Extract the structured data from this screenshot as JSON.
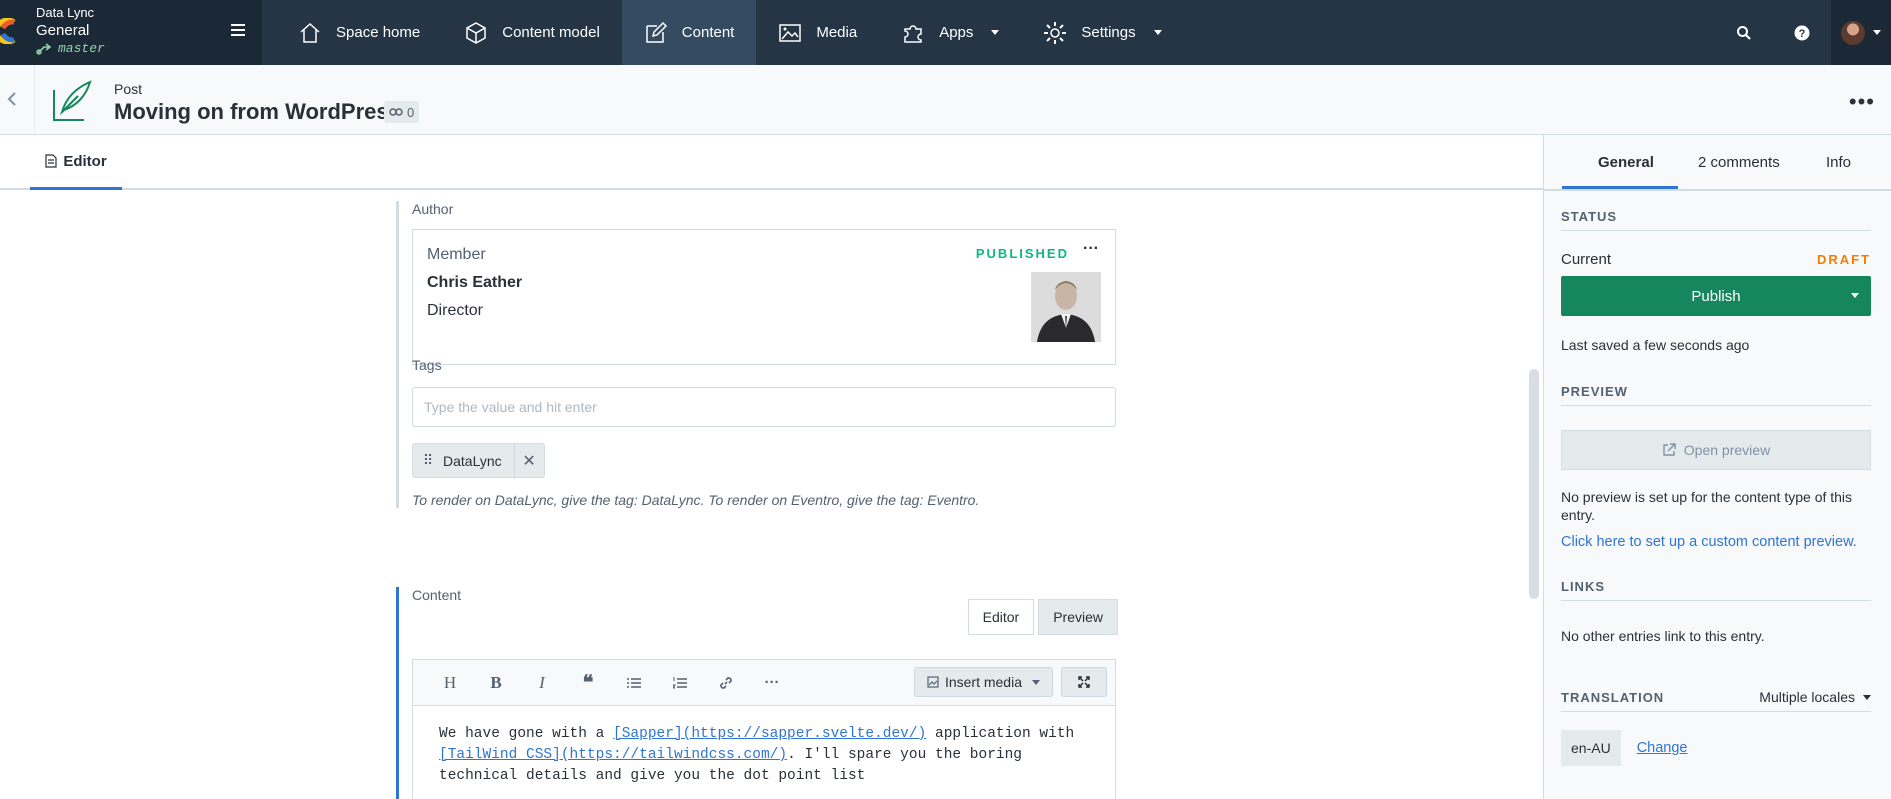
{
  "topnav": {
    "space_org": "Data Lync",
    "space_name": "General",
    "environment": "master",
    "items": [
      {
        "label": "Space home",
        "icon": "house-icon"
      },
      {
        "label": "Content model",
        "icon": "cube-icon"
      },
      {
        "label": "Content",
        "icon": "pencil-square-icon"
      },
      {
        "label": "Media",
        "icon": "image-icon"
      },
      {
        "label": "Apps",
        "icon": "puzzle-icon"
      },
      {
        "label": "Settings",
        "icon": "gear-icon"
      }
    ]
  },
  "entry": {
    "content_type": "Post",
    "title": "Moving on from WordPress",
    "references": "0"
  },
  "editor_tab": "Editor",
  "author_field": {
    "label": "Author",
    "card_type": "Member",
    "name": "Chris Eather",
    "role": "Director",
    "status": "PUBLISHED"
  },
  "tags_field": {
    "label": "Tags",
    "placeholder": "Type the value and hit enter",
    "tags": [
      "DataLync"
    ],
    "help": "To render on DataLync, give the tag: DataLync. To render on Eventro, give the tag: Eventro."
  },
  "content_field": {
    "label": "Content",
    "tab_editor": "Editor",
    "tab_preview": "Preview",
    "insert_media": "Insert media",
    "text_line1_pre": "We have gone with a ",
    "text_link1": "[Sapper](https://sapper.svelte.dev/)",
    "text_line1_post": " application with",
    "text_link2": "[TailWind CSS](https://tailwindcss.com/)",
    "text_line2_post": ". I'll spare you the boring",
    "text_line3": "technical details and give you the dot point list"
  },
  "sidebar": {
    "tabs": [
      "General",
      "2 comments",
      "Info"
    ],
    "status_heading": "STATUS",
    "current_label": "Current",
    "current_status": "DRAFT",
    "publish_label": "Publish",
    "last_saved": "Last saved a few seconds ago",
    "preview_heading": "PREVIEW",
    "open_preview": "Open preview",
    "preview_note": "No preview is set up for the content type of this entry.",
    "preview_link": "Click here to set up a custom content preview.",
    "links_heading": "LINKS",
    "links_note": "No other entries link to this entry.",
    "translation_heading": "TRANSLATION",
    "translation_mode": "Multiple locales",
    "locale": "en-AU",
    "change_link": "Change"
  },
  "colors": {
    "nav_bg": "#253545",
    "accent": "#2e75d4",
    "publish_green": "#16875d",
    "published_text": "#0eb87f",
    "draft_orange": "#f47d00"
  }
}
